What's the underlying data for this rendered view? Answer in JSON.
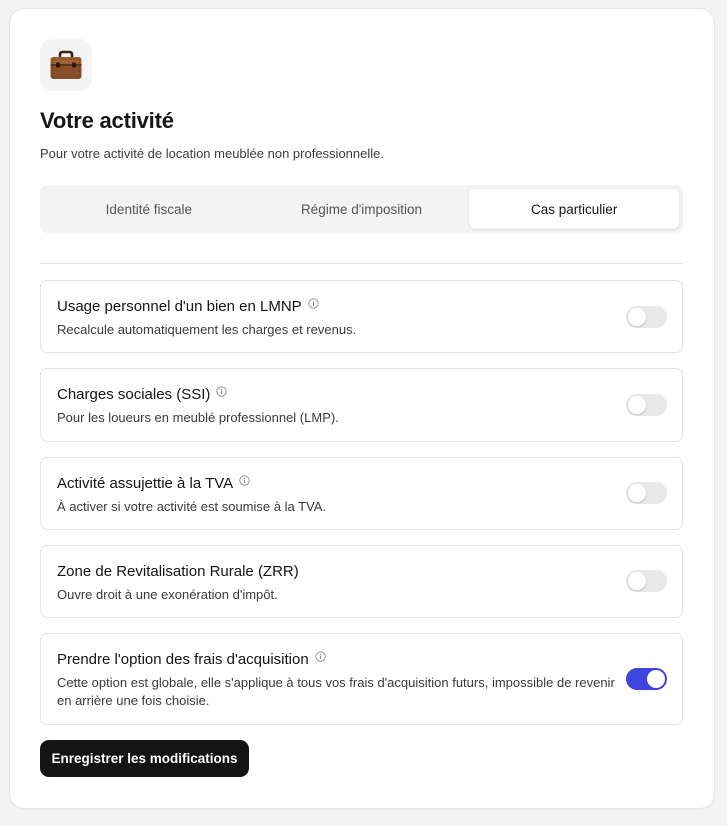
{
  "header": {
    "icon": "briefcase-icon",
    "title": "Votre activité",
    "subtitle": "Pour votre activité de location meublée non professionnelle."
  },
  "tabs": [
    {
      "label": "Identité fiscale",
      "active": false
    },
    {
      "label": "Régime d'imposition",
      "active": false
    },
    {
      "label": "Cas particulier",
      "active": true
    }
  ],
  "options": [
    {
      "title": "Usage personnel d'un bien en LMNP",
      "description": "Recalcule automatiquement les charges et revenus.",
      "info": true,
      "enabled": false
    },
    {
      "title": "Charges sociales (SSI)",
      "description": "Pour les loueurs en meublé professionnel (LMP).",
      "info": true,
      "enabled": false
    },
    {
      "title": "Activité assujettie à la TVA",
      "description": "À activer si votre activité est soumise à la TVA.",
      "info": true,
      "enabled": false
    },
    {
      "title": "Zone de Revitalisation Rurale (ZRR)",
      "description": "Ouvre droit à une exonération d'impôt.",
      "info": false,
      "enabled": false
    },
    {
      "title": "Prendre l'option des frais d'acquisition",
      "description": "Cette option est globale, elle s'applique à tous vos frais d'acquisition futurs, impossible de revenir en arrière une fois choisie.",
      "info": true,
      "enabled": true
    }
  ],
  "actions": {
    "save_label": "Enregistrer les modifications"
  },
  "colors": {
    "toggle_on": "#3f46e0",
    "toggle_off": "#e8e8ea",
    "button_bg": "#141414"
  }
}
